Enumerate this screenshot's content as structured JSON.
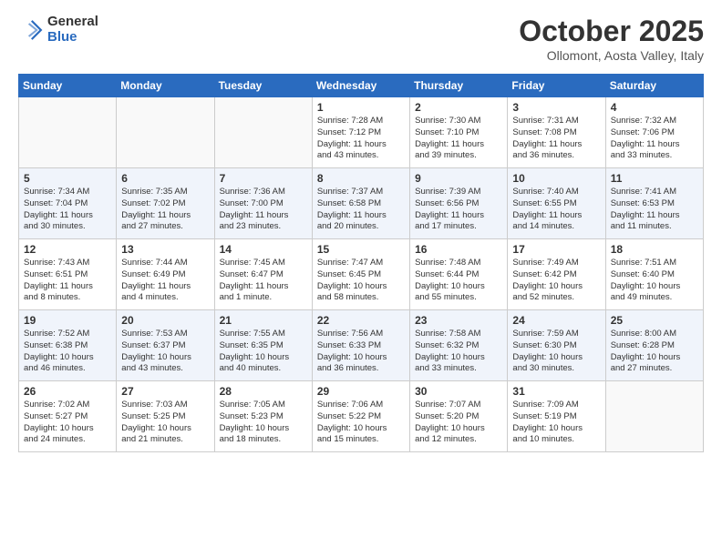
{
  "header": {
    "logo_general": "General",
    "logo_blue": "Blue",
    "month_title": "October 2025",
    "location": "Ollomont, Aosta Valley, Italy"
  },
  "days_of_week": [
    "Sunday",
    "Monday",
    "Tuesday",
    "Wednesday",
    "Thursday",
    "Friday",
    "Saturday"
  ],
  "weeks": [
    [
      {
        "day": "",
        "info": ""
      },
      {
        "day": "",
        "info": ""
      },
      {
        "day": "",
        "info": ""
      },
      {
        "day": "1",
        "info": "Sunrise: 7:28 AM\nSunset: 7:12 PM\nDaylight: 11 hours\nand 43 minutes."
      },
      {
        "day": "2",
        "info": "Sunrise: 7:30 AM\nSunset: 7:10 PM\nDaylight: 11 hours\nand 39 minutes."
      },
      {
        "day": "3",
        "info": "Sunrise: 7:31 AM\nSunset: 7:08 PM\nDaylight: 11 hours\nand 36 minutes."
      },
      {
        "day": "4",
        "info": "Sunrise: 7:32 AM\nSunset: 7:06 PM\nDaylight: 11 hours\nand 33 minutes."
      }
    ],
    [
      {
        "day": "5",
        "info": "Sunrise: 7:34 AM\nSunset: 7:04 PM\nDaylight: 11 hours\nand 30 minutes."
      },
      {
        "day": "6",
        "info": "Sunrise: 7:35 AM\nSunset: 7:02 PM\nDaylight: 11 hours\nand 27 minutes."
      },
      {
        "day": "7",
        "info": "Sunrise: 7:36 AM\nSunset: 7:00 PM\nDaylight: 11 hours\nand 23 minutes."
      },
      {
        "day": "8",
        "info": "Sunrise: 7:37 AM\nSunset: 6:58 PM\nDaylight: 11 hours\nand 20 minutes."
      },
      {
        "day": "9",
        "info": "Sunrise: 7:39 AM\nSunset: 6:56 PM\nDaylight: 11 hours\nand 17 minutes."
      },
      {
        "day": "10",
        "info": "Sunrise: 7:40 AM\nSunset: 6:55 PM\nDaylight: 11 hours\nand 14 minutes."
      },
      {
        "day": "11",
        "info": "Sunrise: 7:41 AM\nSunset: 6:53 PM\nDaylight: 11 hours\nand 11 minutes."
      }
    ],
    [
      {
        "day": "12",
        "info": "Sunrise: 7:43 AM\nSunset: 6:51 PM\nDaylight: 11 hours\nand 8 minutes."
      },
      {
        "day": "13",
        "info": "Sunrise: 7:44 AM\nSunset: 6:49 PM\nDaylight: 11 hours\nand 4 minutes."
      },
      {
        "day": "14",
        "info": "Sunrise: 7:45 AM\nSunset: 6:47 PM\nDaylight: 11 hours\nand 1 minute."
      },
      {
        "day": "15",
        "info": "Sunrise: 7:47 AM\nSunset: 6:45 PM\nDaylight: 10 hours\nand 58 minutes."
      },
      {
        "day": "16",
        "info": "Sunrise: 7:48 AM\nSunset: 6:44 PM\nDaylight: 10 hours\nand 55 minutes."
      },
      {
        "day": "17",
        "info": "Sunrise: 7:49 AM\nSunset: 6:42 PM\nDaylight: 10 hours\nand 52 minutes."
      },
      {
        "day": "18",
        "info": "Sunrise: 7:51 AM\nSunset: 6:40 PM\nDaylight: 10 hours\nand 49 minutes."
      }
    ],
    [
      {
        "day": "19",
        "info": "Sunrise: 7:52 AM\nSunset: 6:38 PM\nDaylight: 10 hours\nand 46 minutes."
      },
      {
        "day": "20",
        "info": "Sunrise: 7:53 AM\nSunset: 6:37 PM\nDaylight: 10 hours\nand 43 minutes."
      },
      {
        "day": "21",
        "info": "Sunrise: 7:55 AM\nSunset: 6:35 PM\nDaylight: 10 hours\nand 40 minutes."
      },
      {
        "day": "22",
        "info": "Sunrise: 7:56 AM\nSunset: 6:33 PM\nDaylight: 10 hours\nand 36 minutes."
      },
      {
        "day": "23",
        "info": "Sunrise: 7:58 AM\nSunset: 6:32 PM\nDaylight: 10 hours\nand 33 minutes."
      },
      {
        "day": "24",
        "info": "Sunrise: 7:59 AM\nSunset: 6:30 PM\nDaylight: 10 hours\nand 30 minutes."
      },
      {
        "day": "25",
        "info": "Sunrise: 8:00 AM\nSunset: 6:28 PM\nDaylight: 10 hours\nand 27 minutes."
      }
    ],
    [
      {
        "day": "26",
        "info": "Sunrise: 7:02 AM\nSunset: 5:27 PM\nDaylight: 10 hours\nand 24 minutes."
      },
      {
        "day": "27",
        "info": "Sunrise: 7:03 AM\nSunset: 5:25 PM\nDaylight: 10 hours\nand 21 minutes."
      },
      {
        "day": "28",
        "info": "Sunrise: 7:05 AM\nSunset: 5:23 PM\nDaylight: 10 hours\nand 18 minutes."
      },
      {
        "day": "29",
        "info": "Sunrise: 7:06 AM\nSunset: 5:22 PM\nDaylight: 10 hours\nand 15 minutes."
      },
      {
        "day": "30",
        "info": "Sunrise: 7:07 AM\nSunset: 5:20 PM\nDaylight: 10 hours\nand 12 minutes."
      },
      {
        "day": "31",
        "info": "Sunrise: 7:09 AM\nSunset: 5:19 PM\nDaylight: 10 hours\nand 10 minutes."
      },
      {
        "day": "",
        "info": ""
      }
    ]
  ]
}
